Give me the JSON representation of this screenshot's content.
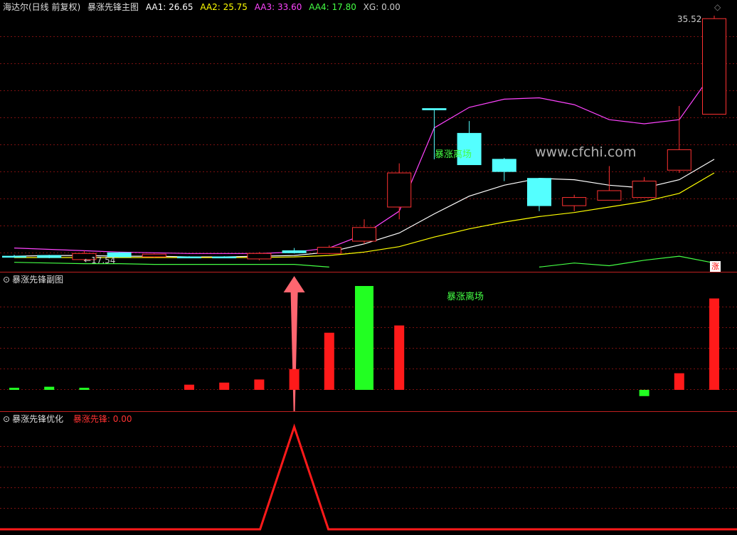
{
  "main_panel": {
    "title": "海达尔(日线 前复权)",
    "indicator_name": "暴涨先锋主图",
    "indicators": [
      {
        "label": "AA1:",
        "value": "26.65",
        "color": "#ffffff"
      },
      {
        "label": "AA2:",
        "value": "25.75",
        "color": "#ffff00"
      },
      {
        "label": "AA3:",
        "value": "33.60",
        "color": "#ff44ff"
      },
      {
        "label": "AA4:",
        "value": "17.80",
        "color": "#44ff44"
      },
      {
        "label": "XG:",
        "value": "0.00",
        "color": "#cccccc"
      }
    ],
    "high_price_label": "35.52",
    "low_price_label": "17.54",
    "exit_label": "暴涨离场",
    "watermark": "www.cfchi.com",
    "zhang_badge": "涨"
  },
  "sub_panel": {
    "title": "暴涨先锋副图",
    "exit_label": "暴涨离场"
  },
  "opt_panel": {
    "title": "暴涨先锋优化",
    "indicator_label": "暴涨先锋:",
    "indicator_value": "0.00"
  },
  "colors": {
    "background": "#000000",
    "up_candle": "#ff3232",
    "down_candle": "#54ffff",
    "grid": "#7a1010",
    "ma_white": "#ffffff",
    "ma_yellow": "#ffff00",
    "ma_magenta": "#ff44ff",
    "ma_green": "#44ff44",
    "bar_red": "#ff1a1a",
    "bar_green": "#22ff22",
    "signal_arrow": "#ff6670"
  },
  "chart_data": {
    "type": "candlestick",
    "price_range": [
      17.54,
      35.52
    ],
    "candles": [
      {
        "o": 17.9,
        "c": 17.9,
        "h": 18.0,
        "l": 17.8,
        "dir": "down"
      },
      {
        "o": 17.95,
        "c": 17.8,
        "h": 18.0,
        "l": 17.75,
        "dir": "down"
      },
      {
        "o": 17.65,
        "c": 18.1,
        "h": 18.3,
        "l": 17.54,
        "dir": "up"
      },
      {
        "o": 18.15,
        "c": 17.85,
        "h": 18.2,
        "l": 17.8,
        "dir": "down"
      },
      {
        "o": 17.85,
        "c": 18.05,
        "h": 18.1,
        "l": 17.8,
        "dir": "up"
      },
      {
        "o": 17.85,
        "c": 17.85,
        "h": 17.9,
        "l": 17.8,
        "dir": "down"
      },
      {
        "o": 17.85,
        "c": 17.85,
        "h": 17.9,
        "l": 17.8,
        "dir": "down"
      },
      {
        "o": 17.7,
        "c": 18.1,
        "h": 18.2,
        "l": 17.6,
        "dir": "up"
      },
      {
        "o": 18.3,
        "c": 18.15,
        "h": 18.5,
        "l": 18.1,
        "dir": "down"
      },
      {
        "o": 18.1,
        "c": 18.55,
        "h": 18.7,
        "l": 18.05,
        "dir": "up"
      },
      {
        "o": 19.0,
        "c": 20.0,
        "h": 20.6,
        "l": 18.8,
        "dir": "up"
      },
      {
        "o": 21.5,
        "c": 24.0,
        "h": 24.7,
        "l": 20.6,
        "dir": "up"
      },
      {
        "o": 28.7,
        "c": 28.7,
        "h": 28.7,
        "l": 25.0,
        "dir": "down"
      },
      {
        "o": 26.9,
        "c": 24.6,
        "h": 27.8,
        "l": 24.6,
        "dir": "down"
      },
      {
        "o": 25.0,
        "c": 24.1,
        "h": 25.1,
        "l": 23.4,
        "dir": "down"
      },
      {
        "o": 23.6,
        "c": 21.6,
        "h": 23.6,
        "l": 21.2,
        "dir": "down"
      },
      {
        "o": 21.6,
        "c": 22.2,
        "h": 22.4,
        "l": 21.2,
        "dir": "up"
      },
      {
        "o": 22.0,
        "c": 22.7,
        "h": 24.5,
        "l": 22.0,
        "dir": "up"
      },
      {
        "o": 22.2,
        "c": 23.4,
        "h": 23.7,
        "l": 22.2,
        "dir": "up"
      },
      {
        "o": 24.2,
        "c": 25.7,
        "h": 28.9,
        "l": 24.0,
        "dir": "up"
      },
      {
        "o": 28.3,
        "c": 35.3,
        "h": 35.52,
        "l": 28.3,
        "dir": "up"
      }
    ],
    "series": [
      {
        "name": "AA1",
        "color": "#ffffff",
        "values": [
          17.9,
          17.95,
          17.95,
          17.9,
          17.9,
          17.85,
          17.85,
          17.9,
          17.95,
          18.2,
          18.8,
          19.6,
          21.0,
          22.3,
          23.1,
          23.6,
          23.5,
          23.1,
          22.9,
          23.5,
          25.0
        ]
      },
      {
        "name": "AA2",
        "color": "#ffff00",
        "values": [
          17.8,
          17.8,
          17.8,
          17.8,
          17.8,
          17.8,
          17.8,
          17.8,
          17.85,
          17.95,
          18.2,
          18.6,
          19.3,
          19.9,
          20.4,
          20.8,
          21.1,
          21.5,
          21.9,
          22.5,
          24.0
        ]
      },
      {
        "name": "AA3",
        "color": "#ff44ff",
        "values": [
          18.5,
          18.4,
          18.3,
          18.2,
          18.15,
          18.1,
          18.1,
          18.1,
          18.2,
          18.5,
          19.5,
          21.2,
          27.3,
          28.8,
          29.4,
          29.5,
          29.0,
          27.9,
          27.6,
          27.9,
          31.5
        ]
      },
      {
        "name": "AA4",
        "color": "#44ff44",
        "values": [
          17.45,
          17.4,
          17.35,
          17.35,
          17.3,
          17.3,
          17.3,
          17.3,
          17.3,
          17.1,
          null,
          null,
          null,
          null,
          null,
          17.1,
          17.4,
          17.2,
          17.6,
          17.9,
          17.4
        ]
      }
    ],
    "sub_bars": [
      0.02,
      0.03,
      0.02,
      null,
      null,
      0.05,
      0.07,
      0.1,
      0.2,
      0.55,
      1.0,
      0.62,
      null,
      null,
      null,
      null,
      null,
      null,
      -0.06,
      0.16,
      0.88
    ],
    "sub_bar_colors": [
      "g",
      "g",
      "g",
      null,
      null,
      "r",
      "r",
      "r",
      "r",
      "r",
      "g",
      "r",
      null,
      null,
      null,
      null,
      null,
      null,
      "g",
      "r",
      "r"
    ],
    "opt_signal": {
      "peak_index": 8,
      "value": 1.0
    }
  }
}
